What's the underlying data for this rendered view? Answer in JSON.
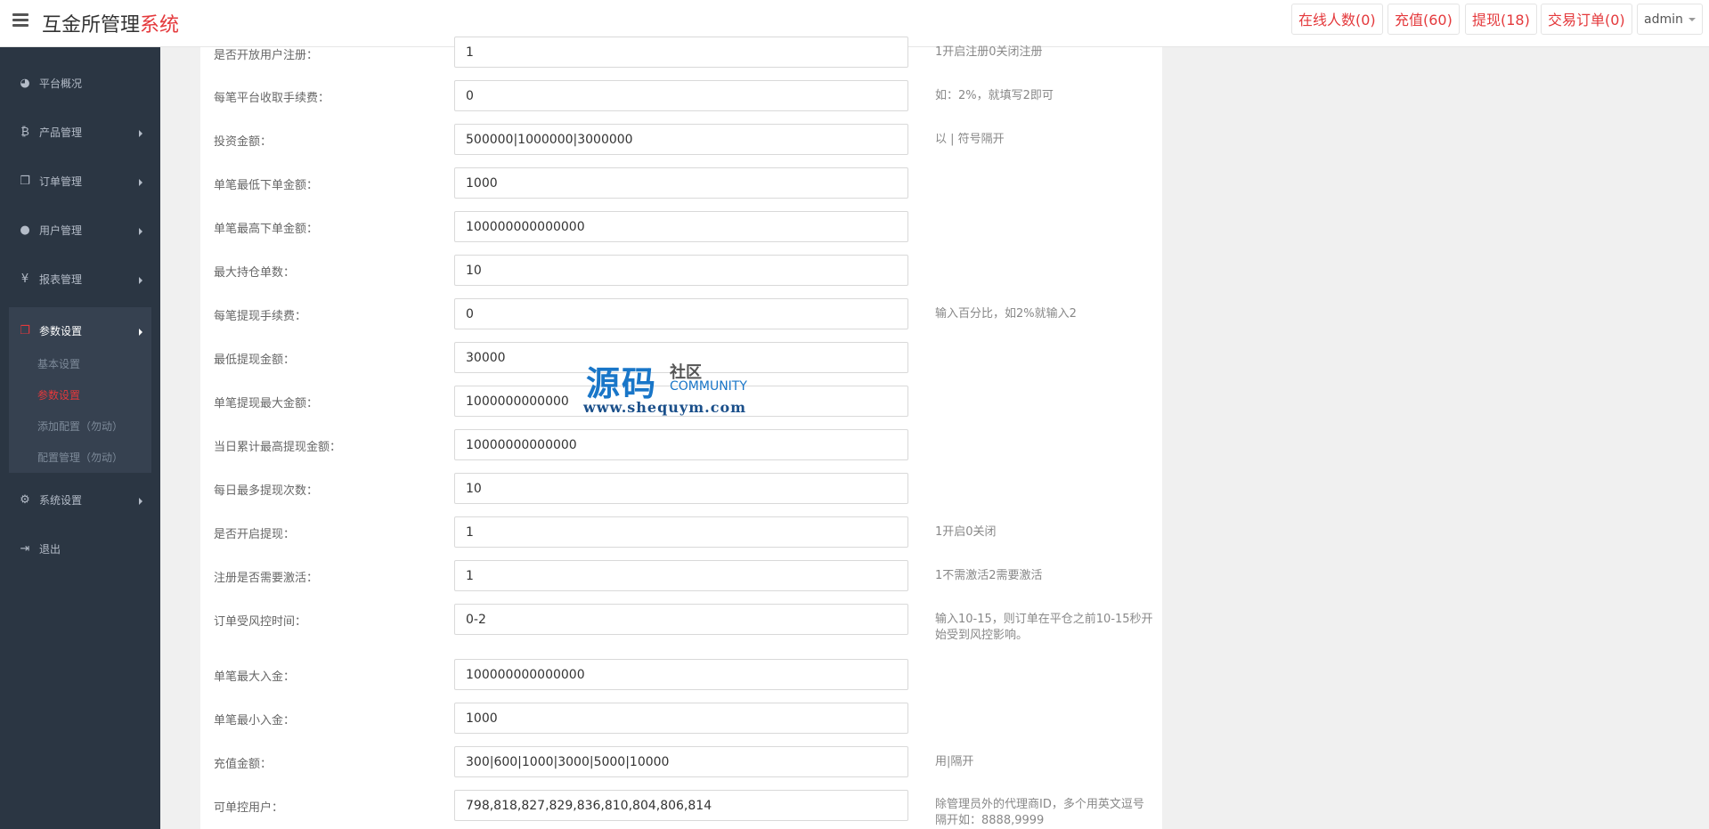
{
  "header": {
    "title_main": "互金所管理",
    "title_accent": "系统",
    "stats": [
      {
        "label": "在线人数(0)"
      },
      {
        "label": "充值(60)"
      },
      {
        "label": "提现(18)"
      },
      {
        "label": "交易订单(0)"
      }
    ],
    "user": "admin"
  },
  "sidebar": {
    "items": [
      {
        "label": "平台概况",
        "icon": "dashboard-icon"
      },
      {
        "label": "产品管理",
        "icon": "bitcoin-icon"
      },
      {
        "label": "订单管理",
        "icon": "copy-icon"
      },
      {
        "label": "用户管理",
        "icon": "user-icon"
      },
      {
        "label": "报表管理",
        "icon": "yen-icon"
      },
      {
        "label": "参数设置",
        "icon": "files-icon"
      },
      {
        "label": "系统设置",
        "icon": "gears-icon"
      },
      {
        "label": "退出",
        "icon": "sign-out-icon"
      }
    ],
    "sub_items": [
      {
        "label": "基本设置"
      },
      {
        "label": "参数设置"
      },
      {
        "label": "添加配置（勿动）"
      },
      {
        "label": "配置管理（勿动）"
      }
    ]
  },
  "form": {
    "rows": [
      {
        "label": "是否开放用户注册：",
        "value": "1",
        "hint": "1开启注册0关闭注册"
      },
      {
        "label": "每笔平台收取手续费：",
        "value": "0",
        "hint": "如：2%，就填写2即可"
      },
      {
        "label": "投资金额：",
        "value": "500000|1000000|3000000",
        "hint": "以 | 符号隔开"
      },
      {
        "label": "单笔最低下单金额：",
        "value": "1000",
        "hint": ""
      },
      {
        "label": "单笔最高下单金额：",
        "value": "100000000000000",
        "hint": ""
      },
      {
        "label": "最大持仓单数：",
        "value": "10",
        "hint": ""
      },
      {
        "label": "每笔提现手续费：",
        "value": "0",
        "hint": "输入百分比，如2%就输入2"
      },
      {
        "label": "最低提现金额：",
        "value": "30000",
        "hint": ""
      },
      {
        "label": "单笔提现最大金额：",
        "value": "1000000000000",
        "hint": ""
      },
      {
        "label": "当日累计最高提现金额：",
        "value": "10000000000000",
        "hint": ""
      },
      {
        "label": "每日最多提现次数：",
        "value": "10",
        "hint": ""
      },
      {
        "label": "是否开启提现：",
        "value": "1",
        "hint": "1开启0关闭"
      },
      {
        "label": "注册是否需要激活：",
        "value": "1",
        "hint": "1不需激活2需要激活"
      },
      {
        "label": "订单受风控时间：",
        "value": "0-2",
        "hint": "输入10-15，则订单在平仓之前10-15秒开始受到风控影响。"
      },
      {
        "label": "单笔最大入金：",
        "value": "100000000000000",
        "hint": ""
      },
      {
        "label": "单笔最小入金：",
        "value": "1000",
        "hint": ""
      },
      {
        "label": "充值金额：",
        "value": "300|600|1000|3000|5000|10000",
        "hint": "用|隔开"
      },
      {
        "label": "可单控用户：",
        "value": "798,818,827,829,836,810,804,806,814",
        "hint": "除管理员外的代理商ID，多个用英文逗号隔开如：8888,9999"
      }
    ]
  },
  "watermark": {
    "big": "源码",
    "small": "社区",
    "community": "COMMUNITY",
    "url": "www.shequym.com"
  }
}
